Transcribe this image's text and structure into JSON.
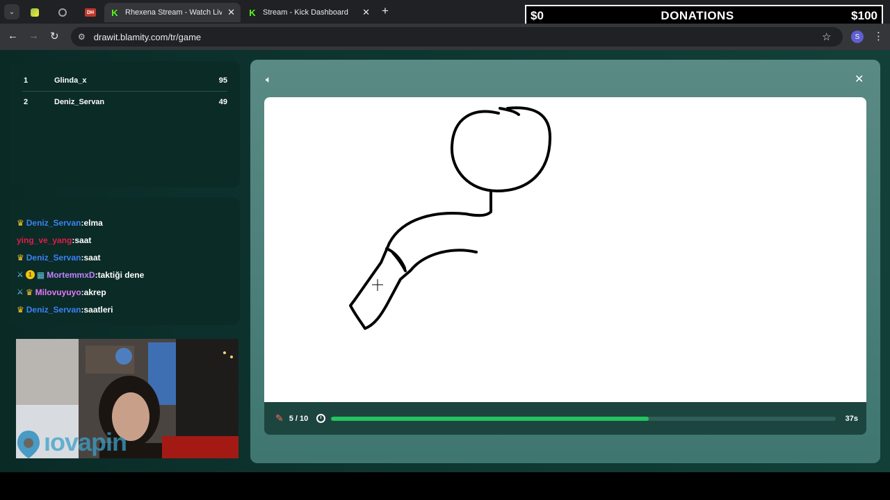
{
  "browser": {
    "tabs": [
      {
        "title": "",
        "favicon": "green-app-icon",
        "active": false
      },
      {
        "title": "",
        "favicon": "globe-icon",
        "active": false
      },
      {
        "title": "",
        "favicon": "dh-icon",
        "favicon_text": "DH",
        "active": false
      },
      {
        "title": "Rhexena Stream - Watch Live o",
        "favicon": "kick-icon",
        "favicon_text": "K",
        "active": true
      },
      {
        "title": "Stream - Kick Dashboard",
        "favicon": "kick-icon",
        "favicon_text": "K",
        "active": false
      }
    ],
    "url": "drawit.blamity.com/tr/game",
    "profile_initial": "S"
  },
  "donations": {
    "left": "$0",
    "title": "DONATIONS",
    "right": "$100"
  },
  "leaderboard": [
    {
      "rank": "1",
      "name": "Glinda_x",
      "score": "95"
    },
    {
      "rank": "2",
      "name": "Deniz_Servan",
      "score": "49"
    }
  ],
  "chat": [
    {
      "user": "Deniz_Servan",
      "color": "#3b82f6",
      "badges": [
        "crown"
      ],
      "text": ":elma"
    },
    {
      "user": "ying_ve_yang",
      "color": "#e11d48",
      "badges": [],
      "text": ":saat"
    },
    {
      "user": "Deniz_Servan",
      "color": "#3b82f6",
      "badges": [
        "crown"
      ],
      "text": ":saat"
    },
    {
      "user": "MortemmxD",
      "color": "#c084fc",
      "badges": [
        "sword",
        "coin",
        "grid"
      ],
      "coin_text": "1",
      "text": ":taktiği dene"
    },
    {
      "user": "Milovuyuyo",
      "color": "#e879f9",
      "badges": [
        "sword",
        "crown"
      ],
      "text": ":akrep"
    },
    {
      "user": "Deniz_Servan",
      "color": "#3b82f6",
      "badges": [
        "crown"
      ],
      "text": ":saatleri"
    }
  ],
  "webcam": {
    "overlay_logo": "ıovapin"
  },
  "game": {
    "round": "5 / 10",
    "time_left": "37s",
    "progress_fraction": 0.63,
    "accent": "#22c55e"
  }
}
